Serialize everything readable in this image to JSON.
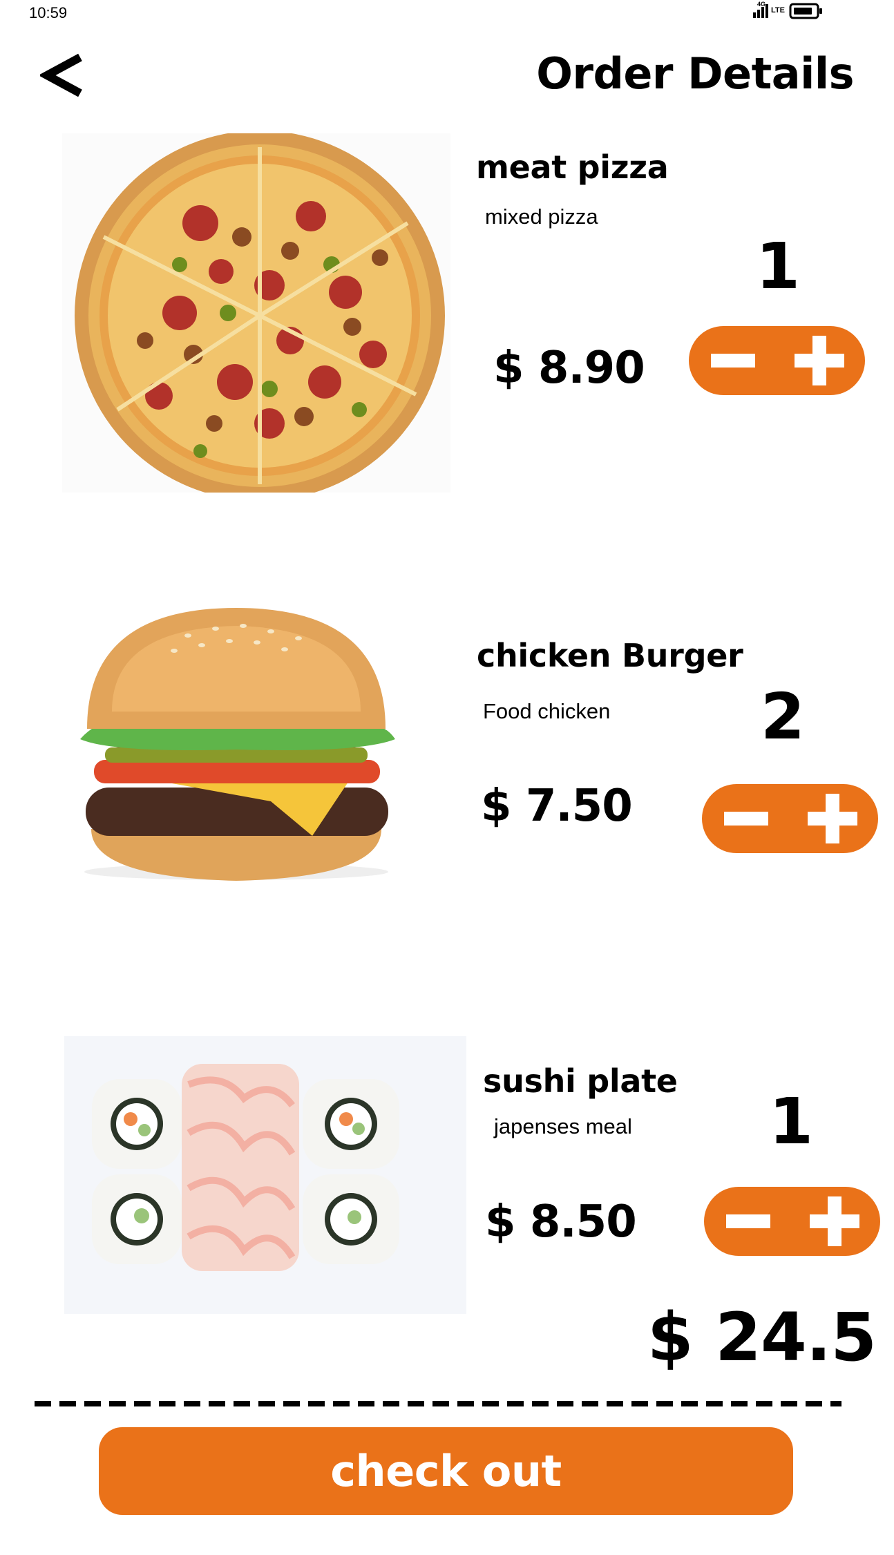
{
  "colors": {
    "accent": "#EA7219",
    "text": "#000000",
    "background": "#FFFFFF"
  },
  "status_bar": {
    "time": "10:59",
    "network_label": "LTE",
    "network_generation": "4G",
    "icons": [
      "signal-icon",
      "battery-icon"
    ]
  },
  "header": {
    "back_icon": "back-chevron-icon",
    "title": "Order Details"
  },
  "items": [
    {
      "name": "meat pizza",
      "description": "mixed pizza",
      "quantity": "1",
      "price": "$ 8.90",
      "image": "pizza-image"
    },
    {
      "name": "chicken  Burger",
      "description": "Food chicken",
      "quantity": "2",
      "price": "$ 7.50",
      "image": "burger-image"
    },
    {
      "name": "sushi plate",
      "description": "japenses meal",
      "quantity": "1",
      "price": "$ 8.50",
      "image": "sushi-image"
    }
  ],
  "stepper": {
    "minus_icon": "minus-icon",
    "plus_icon": "plus-icon"
  },
  "total": "$ 24.5",
  "checkout": {
    "label": "check out"
  }
}
